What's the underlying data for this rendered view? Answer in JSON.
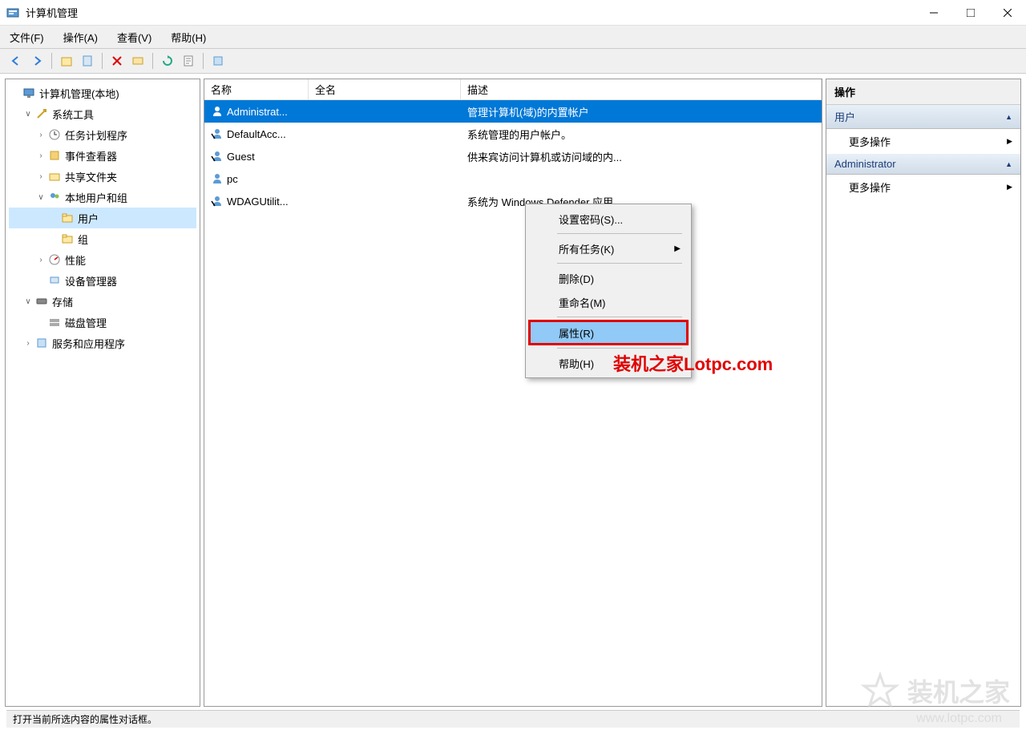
{
  "window": {
    "title": "计算机管理"
  },
  "menubar": {
    "file": "文件(F)",
    "action": "操作(A)",
    "view": "查看(V)",
    "help": "帮助(H)"
  },
  "tree": {
    "root": "计算机管理(本地)",
    "systools": "系统工具",
    "tasksched": "任务计划程序",
    "eventviewer": "事件查看器",
    "sharedfolders": "共享文件夹",
    "localusers": "本地用户和组",
    "users": "用户",
    "groups": "组",
    "performance": "性能",
    "devmgr": "设备管理器",
    "storage": "存储",
    "diskmgmt": "磁盘管理",
    "services": "服务和应用程序"
  },
  "columns": {
    "name": "名称",
    "fullname": "全名",
    "description": "描述"
  },
  "users_list": [
    {
      "name": "Administrat...",
      "fullname": "",
      "desc": "管理计算机(域)的内置帐户"
    },
    {
      "name": "DefaultAcc...",
      "fullname": "",
      "desc": "系统管理的用户帐户。"
    },
    {
      "name": "Guest",
      "fullname": "",
      "desc": "供来宾访问计算机或访问域的内..."
    },
    {
      "name": "pc",
      "fullname": "",
      "desc": ""
    },
    {
      "name": "WDAGUtilit...",
      "fullname": "",
      "desc": "系统为 Windows Defender 应用..."
    }
  ],
  "context_menu": {
    "set_password": "设置密码(S)...",
    "all_tasks": "所有任务(K)",
    "delete": "删除(D)",
    "rename": "重命名(M)",
    "properties": "属性(R)",
    "help": "帮助(H)"
  },
  "actions": {
    "header": "操作",
    "section1": "用户",
    "more1": "更多操作",
    "section2": "Administrator",
    "more2": "更多操作"
  },
  "statusbar": "打开当前所选内容的属性对话框。",
  "annotation": "装机之家Lotpc.com",
  "watermark": {
    "text": "装机之家",
    "url": "www.lotpc.com"
  }
}
